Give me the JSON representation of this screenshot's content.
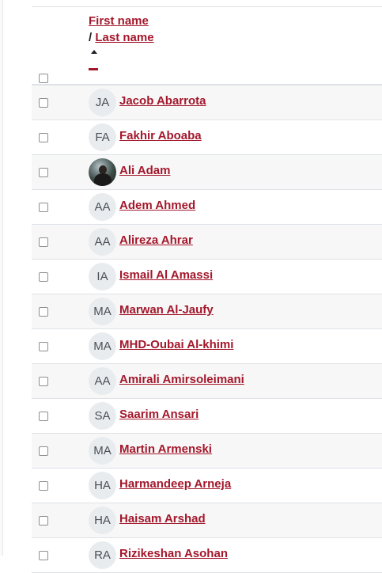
{
  "header": {
    "first_name_label": "First name",
    "separator": "/",
    "last_name_label": "Last name",
    "sort_icon": "sort-ascending-icon",
    "hide_icon": "minus-icon"
  },
  "colors": {
    "link": "#a3172b",
    "border": "#dee2e6",
    "stripe": "#f7f7f7"
  },
  "users": [
    {
      "initials": "JA",
      "name": "Jacob Abarrota"
    },
    {
      "initials": "FA",
      "name": "Fakhir Aboaba"
    },
    {
      "initials": "",
      "name": "Ali Adam",
      "photo": true
    },
    {
      "initials": "AA",
      "name": "Adem Ahmed"
    },
    {
      "initials": "AA",
      "name": "Alireza Ahrar"
    },
    {
      "initials": "IA",
      "name": "Ismail Al Amassi"
    },
    {
      "initials": "MA",
      "name": "Marwan Al-Jaufy"
    },
    {
      "initials": "MA",
      "name": "MHD-Oubai Al-khimi"
    },
    {
      "initials": "AA",
      "name": "Amirali Amirsoleimani"
    },
    {
      "initials": "SA",
      "name": "Saarim Ansari"
    },
    {
      "initials": "MA",
      "name": "Martin Armenski"
    },
    {
      "initials": "HA",
      "name": "Harmandeep Arneja"
    },
    {
      "initials": "HA",
      "name": "Haisam Arshad"
    },
    {
      "initials": "RA",
      "name": "Rizikeshan Asohan"
    }
  ]
}
